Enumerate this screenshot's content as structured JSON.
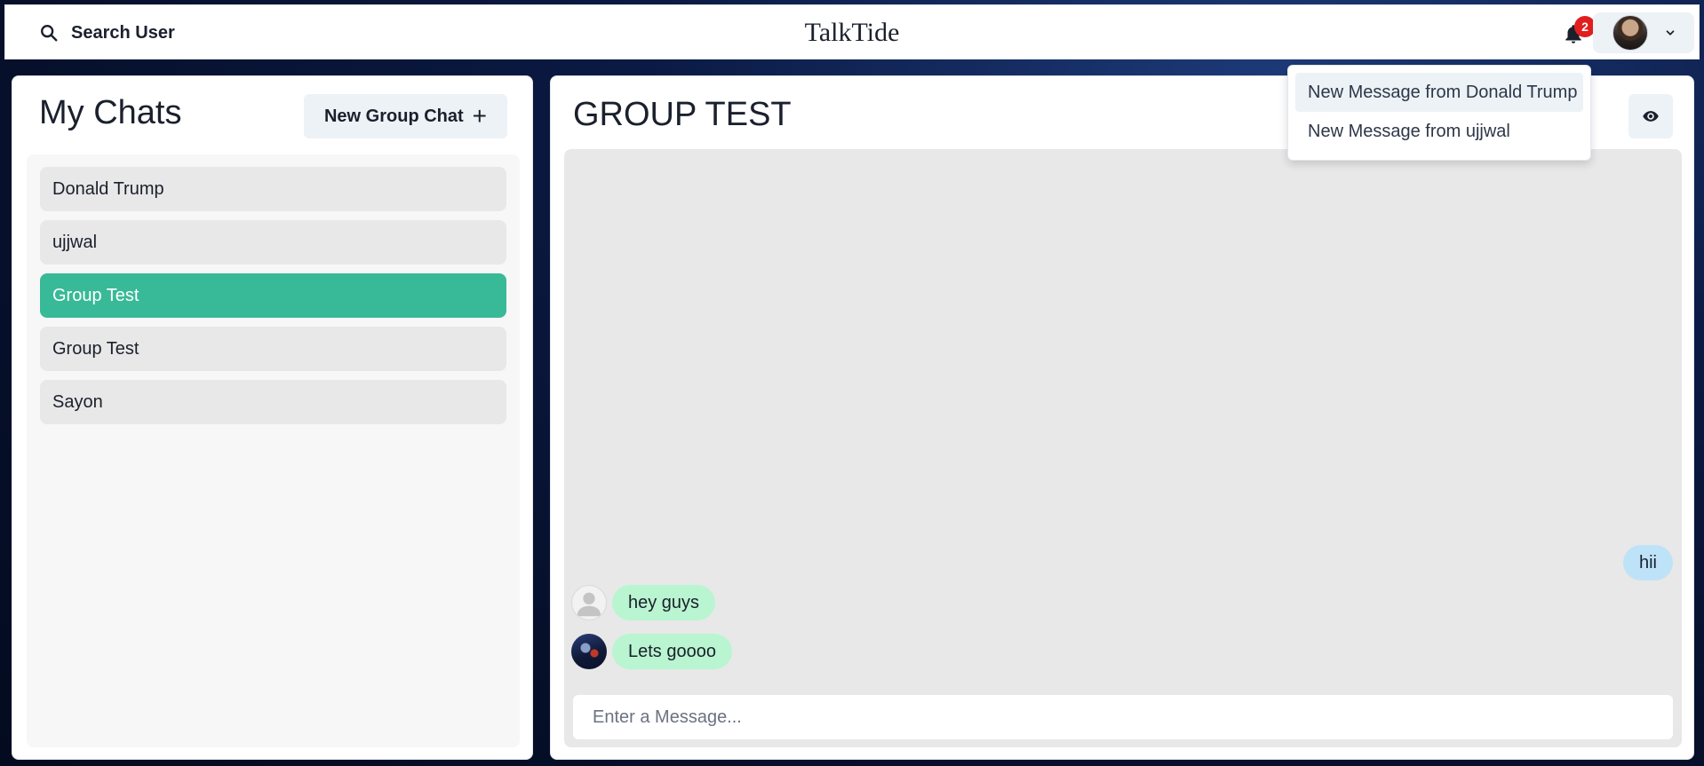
{
  "header": {
    "search_label": "Search User",
    "brand": "TalkTide",
    "notification_count": "2"
  },
  "notifications": [
    {
      "label": "New Message from Donald Trump",
      "active": true
    },
    {
      "label": "New Message from ujjwal",
      "active": false
    }
  ],
  "sidebar": {
    "title": "My Chats",
    "new_group_label": "New Group Chat",
    "new_group_icon": "+",
    "chats": [
      {
        "name": "Donald Trump",
        "selected": false
      },
      {
        "name": "ujjwal",
        "selected": false
      },
      {
        "name": "Group Test",
        "selected": true
      },
      {
        "name": "Group Test",
        "selected": false
      },
      {
        "name": "Sayon",
        "selected": false
      }
    ]
  },
  "chat": {
    "title": "GROUP TEST",
    "messages": [
      {
        "text": "hii",
        "sender": "me"
      },
      {
        "text": "hey guys",
        "sender": "default-avatar"
      },
      {
        "text": "Lets goooo",
        "sender": "photo-avatar"
      }
    ],
    "input_placeholder": "Enter a Message..."
  },
  "colors": {
    "selected_chat": "#38b998",
    "my_message": "#bee3f8",
    "their_message": "#b9f5d0",
    "badge": "#e11d1d"
  },
  "icons": {
    "search": "search-icon",
    "bell": "bell-icon",
    "chevron": "chevron-down-icon",
    "eye": "eye-icon"
  }
}
